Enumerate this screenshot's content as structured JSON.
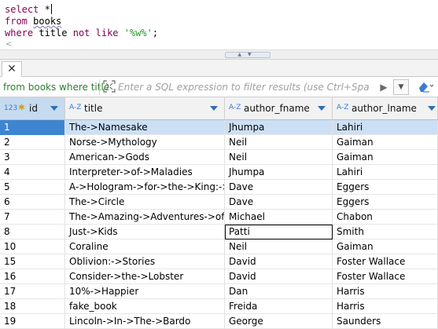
{
  "editor": {
    "lines": [
      {
        "kw1": "select",
        "rest": " *"
      },
      {
        "kw1": "from",
        "ident": "books"
      },
      {
        "kw1": "where",
        "ident": "title",
        "kw2": "not like",
        "str": "'%w%'",
        "end": ";"
      }
    ],
    "scroll_arrow": "<"
  },
  "results": {
    "tab_close": "✕",
    "filter_prefix": "from books where title",
    "filter_placeholder": "Enter a SQL expression to filter results (use Ctrl+Space)",
    "run_glyph": "▶",
    "dropdown_glyph": "▼",
    "columns": [
      {
        "type": "123",
        "name": "id",
        "key": true
      },
      {
        "type": "A-Z",
        "name": "title"
      },
      {
        "type": "A-Z",
        "name": "author_fname"
      },
      {
        "type": "A-Z",
        "name": "author_lname"
      }
    ],
    "rows": [
      [
        "1",
        "The->Namesake",
        "Jhumpa",
        "Lahiri"
      ],
      [
        "2",
        "Norse->Mythology",
        "Neil",
        "Gaiman"
      ],
      [
        "3",
        "American->Gods",
        "Neil",
        "Gaiman"
      ],
      [
        "4",
        "Interpreter->of->Maladies",
        "Jhumpa",
        "Lahiri"
      ],
      [
        "5",
        "A->Hologram->for->the->King:->A-",
        "Dave",
        "Eggers"
      ],
      [
        "6",
        "The->Circle",
        "Dave",
        "Eggers"
      ],
      [
        "7",
        "The->Amazing->Adventures->of->K",
        "Michael",
        "Chabon"
      ],
      [
        "8",
        "Just->Kids",
        "Patti",
        "Smith"
      ],
      [
        "10",
        "Coraline",
        "Neil",
        "Gaiman"
      ],
      [
        "15",
        "Oblivion:->Stories",
        "David",
        "Foster Wallace"
      ],
      [
        "16",
        "Consider->the->Lobster",
        "David",
        "Foster Wallace"
      ],
      [
        "17",
        "10%->Happier",
        "Dan",
        "Harris"
      ],
      [
        "18",
        "fake_book",
        "Freida",
        "Harris"
      ],
      [
        "19",
        "Lincoln->In->The->Bardo",
        "George",
        "Saunders"
      ]
    ],
    "selected_row": 0,
    "focused_cell": {
      "row": 7,
      "col": 2
    }
  }
}
